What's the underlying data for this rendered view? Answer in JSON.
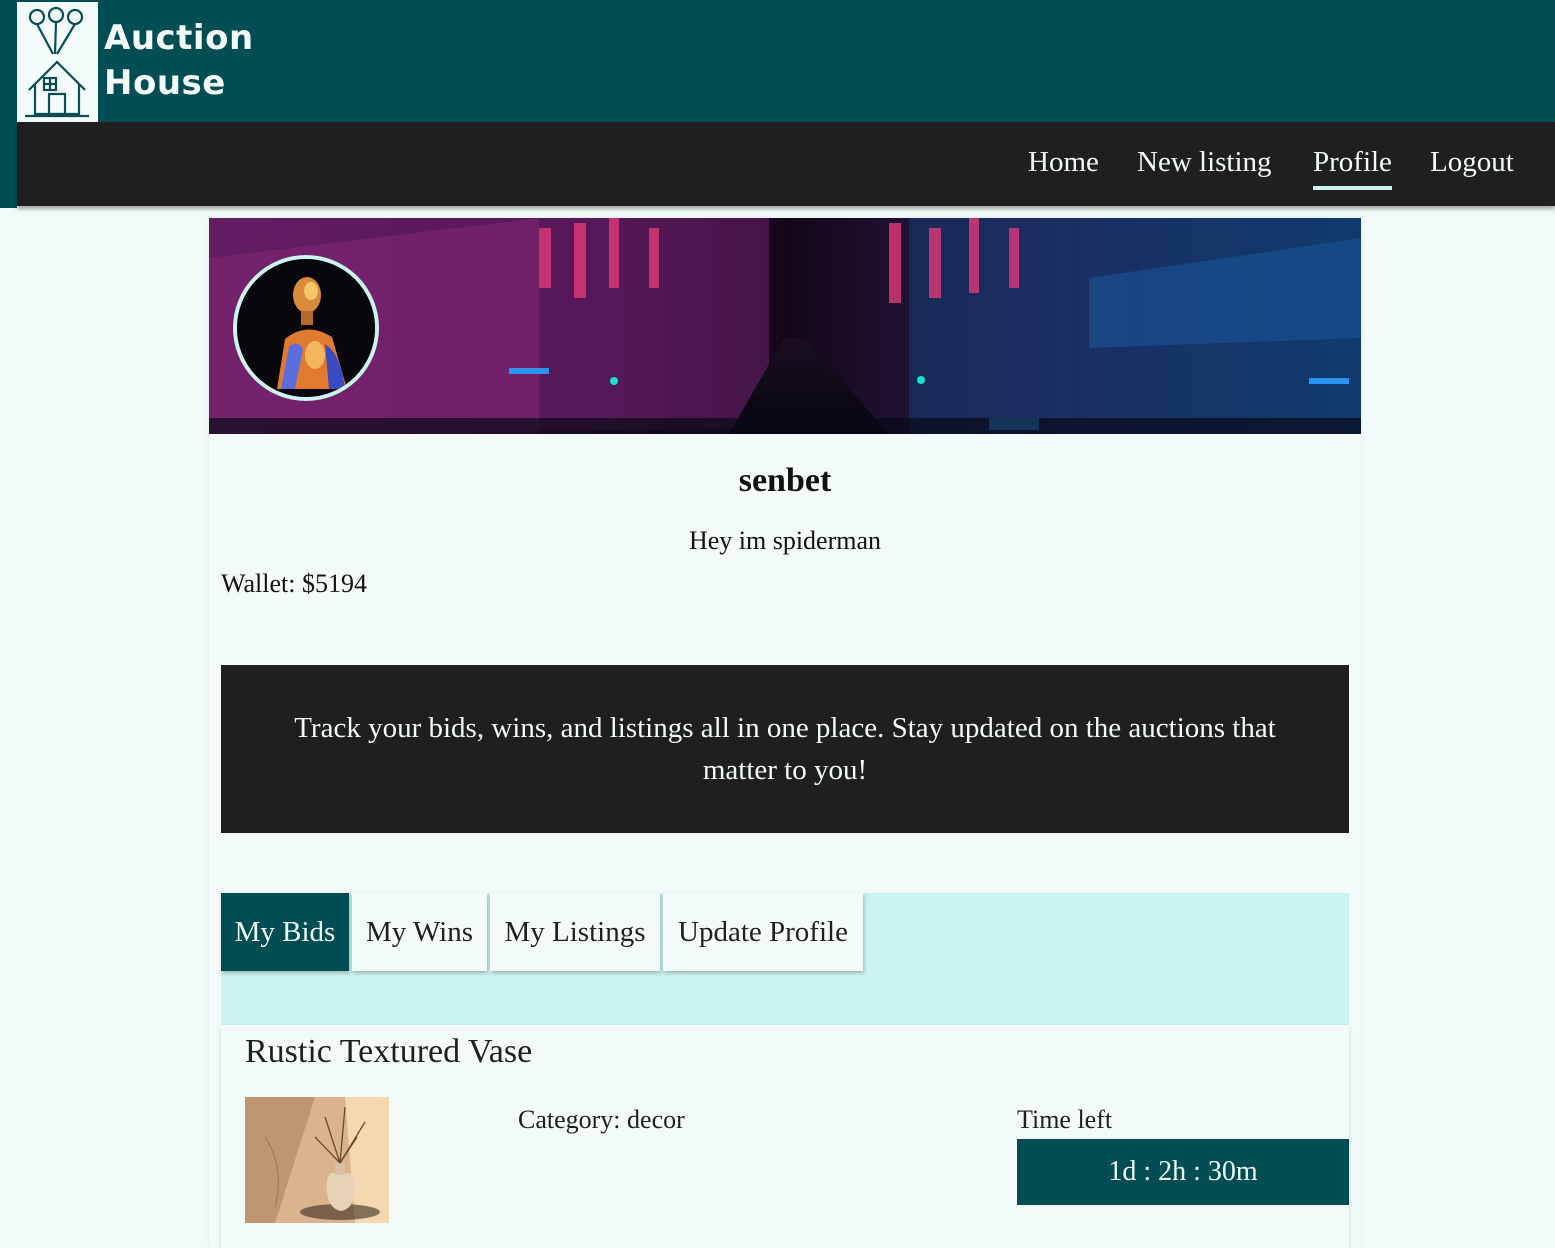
{
  "header": {
    "logo_line1": "Auction",
    "logo_line2": "House"
  },
  "nav": {
    "items": [
      {
        "label": "Home"
      },
      {
        "label": "New listing"
      },
      {
        "label": "Profile",
        "active": true
      },
      {
        "label": "Logout"
      }
    ]
  },
  "profile": {
    "username": "senbet",
    "bio": "Hey im spiderman",
    "wallet_label": "Wallet:",
    "wallet_amount": "$5194"
  },
  "promo": {
    "text": "Track your bids, wins, and listings all in one place. Stay updated on the auctions that matter to you!"
  },
  "tabs": [
    {
      "label": "My Bids",
      "active": true
    },
    {
      "label": "My Wins"
    },
    {
      "label": "My Listings"
    },
    {
      "label": "Update Profile"
    }
  ],
  "listing": {
    "title": "Rustic Textured Vase",
    "category_label": "Category:",
    "category": "decor",
    "time_label": "Time left",
    "time_left": "1d : 2h : 30m"
  },
  "colors": {
    "primary": "#004e53",
    "dark": "#1f1f1f",
    "light": "#f3fbfa",
    "accent": "#cbf3ef"
  },
  "icons": {
    "logo": "balloon-house-icon"
  }
}
